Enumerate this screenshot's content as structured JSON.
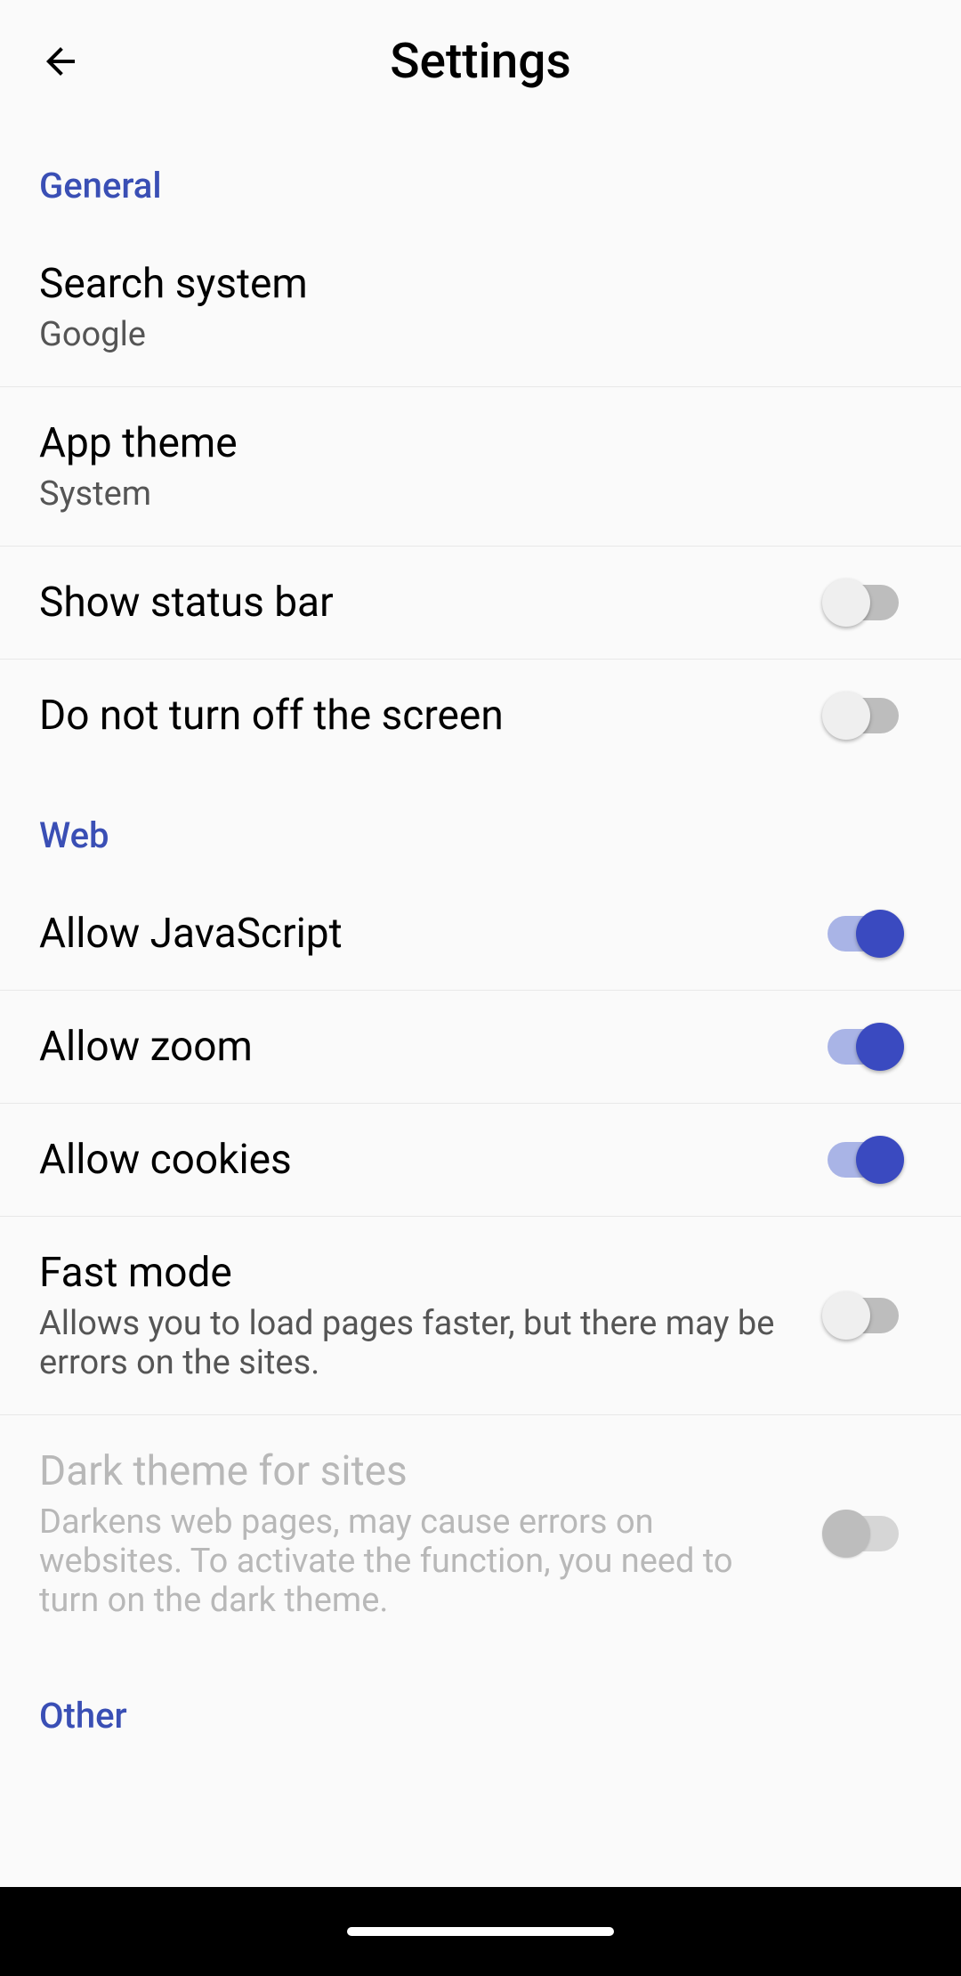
{
  "header": {
    "title": "Settings"
  },
  "sections": {
    "general": {
      "label": "General",
      "search_system": {
        "title": "Search system",
        "value": "Google"
      },
      "app_theme": {
        "title": "App theme",
        "value": "System"
      },
      "show_status_bar": {
        "title": "Show status bar",
        "state": "off"
      },
      "keep_screen_on": {
        "title": "Do not turn off the screen",
        "state": "off"
      }
    },
    "web": {
      "label": "Web",
      "allow_js": {
        "title": "Allow JavaScript",
        "state": "on"
      },
      "allow_zoom": {
        "title": "Allow zoom",
        "state": "on"
      },
      "allow_cookies": {
        "title": "Allow cookies",
        "state": "on"
      },
      "fast_mode": {
        "title": "Fast mode",
        "sub": "Allows you to load pages faster, but there may be errors on the sites.",
        "state": "off"
      },
      "dark_sites": {
        "title": "Dark theme for sites",
        "sub": "Darkens web pages, may cause errors on websites. To activate the function, you need to turn on the dark theme.",
        "state": "off",
        "disabled": true
      }
    },
    "other": {
      "label": "Other"
    }
  },
  "colors": {
    "accent": "#3a4ac0",
    "section_header": "#3a4fb5"
  }
}
